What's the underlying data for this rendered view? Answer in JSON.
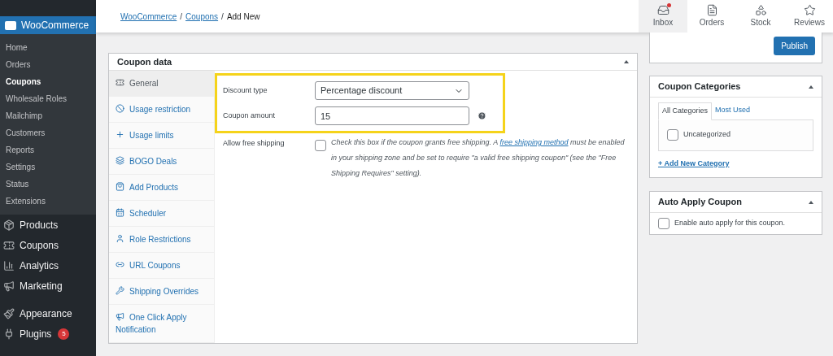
{
  "sidebar": {
    "section": {
      "label": "WooCommerce",
      "selected": true,
      "items": [
        {
          "label": "Home",
          "selected": false
        },
        {
          "label": "Orders",
          "selected": false
        },
        {
          "label": "Coupons",
          "selected": true
        },
        {
          "label": "Wholesale Roles",
          "selected": false
        },
        {
          "label": "Mailchimp",
          "selected": false
        },
        {
          "label": "Customers",
          "selected": false
        },
        {
          "label": "Reports",
          "selected": false
        },
        {
          "label": "Settings",
          "selected": false
        },
        {
          "label": "Status",
          "selected": false
        },
        {
          "label": "Extensions",
          "selected": false
        }
      ]
    },
    "menu": [
      {
        "label": "Products",
        "selected": false
      },
      {
        "label": "Coupons",
        "selected": false
      },
      {
        "label": "Analytics",
        "selected": false
      },
      {
        "label": "Marketing",
        "selected": false
      },
      {
        "label": "Appearance",
        "selected": false
      },
      {
        "label": "Plugins",
        "selected": false,
        "badge": "5"
      }
    ]
  },
  "header": {
    "breadcrumb": [
      {
        "kind": "link",
        "label": "WooCommerce"
      },
      {
        "kind": "separator",
        "label": "/"
      },
      {
        "kind": "link",
        "label": "Coupons"
      },
      {
        "kind": "separator",
        "label": "/"
      },
      {
        "kind": "current",
        "label": "Add New"
      }
    ],
    "activity_tabs": [
      {
        "label": "Inbox",
        "selected": true,
        "unread": true
      },
      {
        "label": "Orders",
        "selected": false,
        "unread": false
      },
      {
        "label": "Stock",
        "selected": false,
        "unread": false
      },
      {
        "label": "Reviews",
        "selected": false,
        "unread": false
      }
    ]
  },
  "coupon_data": {
    "title": "Coupon data",
    "tabs": [
      {
        "label": "General",
        "selected": true
      },
      {
        "label": "Usage restriction",
        "selected": false
      },
      {
        "label": "Usage limits",
        "selected": false
      },
      {
        "label": "BOGO Deals",
        "selected": false
      },
      {
        "label": "Add Products",
        "selected": false
      },
      {
        "label": "Scheduler",
        "selected": false
      },
      {
        "label": "Role Restrictions",
        "selected": false
      },
      {
        "label": "URL Coupons",
        "selected": false
      },
      {
        "label": "Shipping Overrides",
        "selected": false
      },
      {
        "label": "One Click Apply Notification",
        "selected": false
      }
    ],
    "discount_type": {
      "label": "Discount type",
      "value": "Percentage discount"
    },
    "coupon_amount": {
      "label": "Coupon amount",
      "value": "15"
    },
    "free_shipping": {
      "label": "Allow free shipping",
      "checked": false,
      "description_before": "Check this box if the coupon grants free shipping. A ",
      "link": "free shipping method",
      "description_after": " must be enabled in your shipping zone and be set to require \"a valid free shipping coupon\" (see the \"Free Shipping Requires\" setting)."
    }
  },
  "publish": {
    "button": "Publish"
  },
  "coupon_categories": {
    "title": "Coupon Categories",
    "tabs": [
      {
        "label": "All Categories",
        "selected": true
      },
      {
        "label": "Most Used",
        "selected": false
      }
    ],
    "items": [
      {
        "label": "Uncategorized",
        "checked": false
      }
    ],
    "add_link": "+ Add New Category"
  },
  "auto_apply": {
    "title": "Auto Apply Coupon",
    "label": "Enable auto apply for this coupon.",
    "checked": false
  }
}
